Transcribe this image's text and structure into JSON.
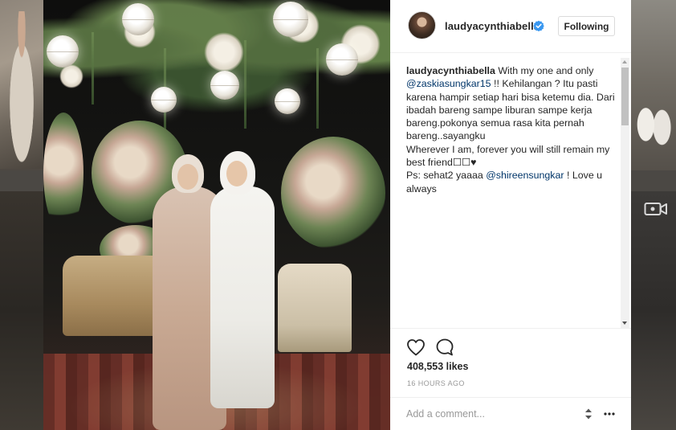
{
  "post": {
    "username": "laudyacynthiabella",
    "follow_label": "Following",
    "caption": {
      "username": "laudyacynthiabella",
      "text_1": " With my one and only ",
      "mention_1": "@zaskiasungkar15",
      "text_2": " !! Kehilangan ? Itu pasti karena hampir setiap hari bisa ketemu dia. Dari ibadah bareng sampe liburan sampe kerja bareng.pokonya semua rasa kita pernah bareng..sayangku",
      "text_3": "Wherever I am, forever you will still remain my best friend☐☐♥",
      "text_4": "Ps: sehat2 yaaaa ",
      "mention_2": "@shireensungkar",
      "text_5": " ! Love u always"
    },
    "likes": "408,553 likes",
    "time": "16 HOURS AGO",
    "comment_placeholder": "Add a comment..."
  },
  "colors": {
    "verified": "#3897f0",
    "mention": "#003569",
    "text": "#262626",
    "muted": "#999999"
  },
  "icons": [
    "verified-badge-icon",
    "heart-icon",
    "comment-bubble-icon",
    "more-options-icon",
    "video-camera-icon",
    "stepper-icon"
  ]
}
